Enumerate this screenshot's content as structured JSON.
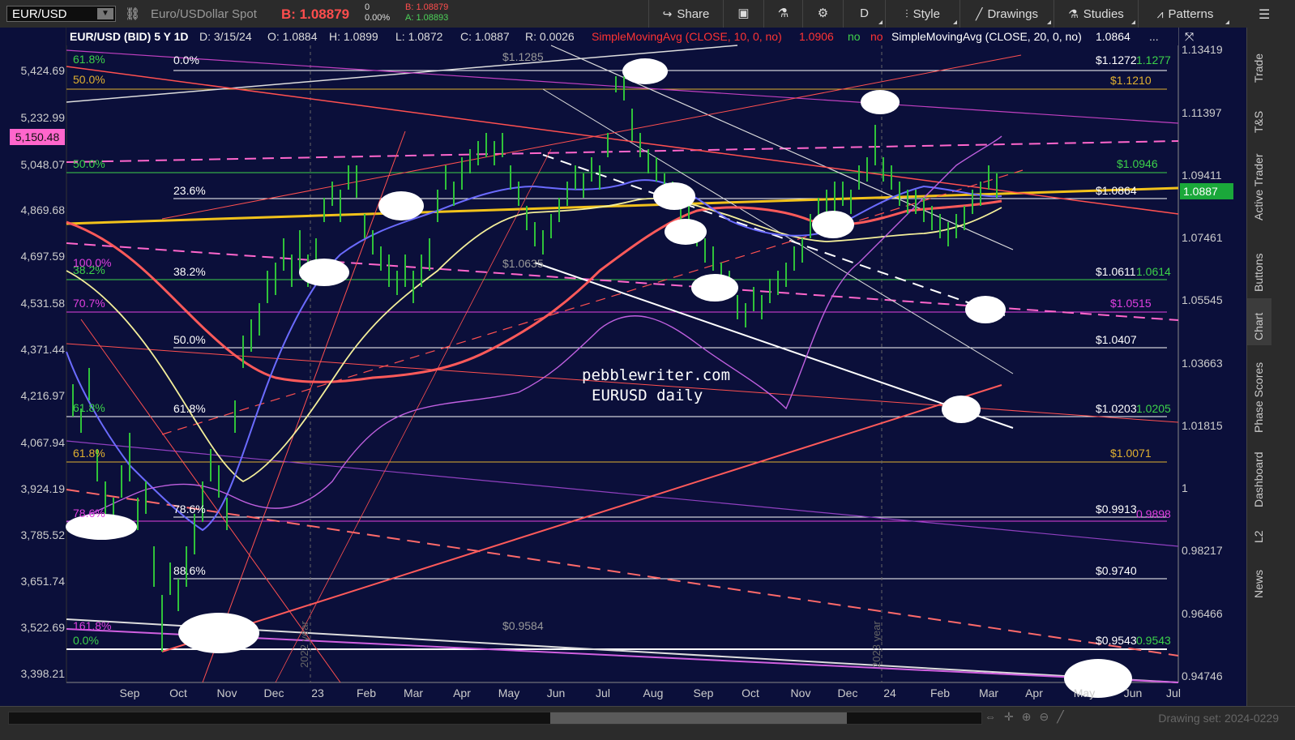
{
  "header": {
    "symbol": "EUR/USD",
    "description": "Euro/USDollar Spot",
    "bid": "B: 1.08879",
    "change": "0",
    "change_pct": "0.00%",
    "bid_small": "B: 1.08879",
    "ask_small": "A: 1.08893",
    "buttons": {
      "share": "Share",
      "period": "D",
      "style": "Style",
      "drawings": "Drawings",
      "studies": "Studies",
      "patterns": "Patterns"
    }
  },
  "chart": {
    "info": {
      "symbol_period": "EUR/USD (BID) 5 Y 1D",
      "date": "D: 3/15/24",
      "open": "O: 1.0884",
      "high": "H: 1.0899",
      "low": "L: 1.0872",
      "close": "C: 1.0887",
      "range": "R: 0.0026",
      "sma10": "SimpleMovingAvg (CLOSE, 10, 0, no)",
      "sma10_val": "1.0906",
      "no1": "no",
      "no2": "no",
      "sma20": "SimpleMovingAvg (CLOSE, 20, 0, no)",
      "sma20_val": "1.0864",
      "more": "..."
    },
    "watermark_1": "pebblewriter.com",
    "watermark_2": "EURUSD daily",
    "left_axis": [
      "5,424.69",
      "5,232.99",
      "5,048.07",
      "4,869.68",
      "4,697.59",
      "4,531.58",
      "4,371.44",
      "4,216.97",
      "4,067.94",
      "3,924.19",
      "3,785.52",
      "3,651.74",
      "3,522.69",
      "3,398.21"
    ],
    "left_current": "5,150.48",
    "right_axis": [
      "1.13419",
      "1.11397",
      "1.09411",
      "1.07461",
      "1.05545",
      "1.03663",
      "1.01815",
      "1",
      "0.98217",
      "0.96466",
      "0.94746"
    ],
    "right_current": "1.0887",
    "x_axis": [
      "Sep",
      "Oct",
      "Nov",
      "Dec",
      "23",
      "Feb",
      "Mar",
      "Apr",
      "May",
      "Jun",
      "Jul",
      "Aug",
      "Sep",
      "Oct",
      "Nov",
      "Dec",
      "24",
      "Feb",
      "Mar",
      "Apr",
      "May",
      "Jun",
      "Jul"
    ],
    "year_marks": [
      "2022 year",
      "2023 year"
    ],
    "fib_levels": [
      {
        "pct": "0.0%",
        "price": "$1.1272"
      },
      {
        "pct": "23.6%",
        "price": "$1.0864"
      },
      {
        "pct": "38.2%",
        "price": "$1.0611"
      },
      {
        "pct": "50.0%",
        "price": "$1.0407"
      },
      {
        "pct": "61.8%",
        "price": "$1.0203"
      },
      {
        "pct": "78.6%",
        "price": "$0.9913"
      },
      {
        "pct": "88.6%",
        "price": "$0.9740"
      }
    ],
    "colored_levels": {
      "a": "50.0%",
      "a_price": "$1.1210",
      "b": "50.0%",
      "b_price": "$1.0946",
      "c": "70.7%",
      "c_price": "$1.0515",
      "d": "61.8%",
      "d_price": "$1.0071",
      "e": "161.8%",
      "e_bottom": "0.0%",
      "e_price": "$0.9543",
      "f": "78.6%",
      "g": "38.2%",
      "h": "100.0%",
      "i": "61.8%",
      "j": "61.8%"
    },
    "overlap_labels": {
      "top_green": "1.1277",
      "mid_green": "1.0614",
      "green_2": "1.0205",
      "pink_low": "0.9898",
      "green_low": "0.9543"
    },
    "inline_prices": {
      "p1": "$1.1285",
      "p2": "$1.0635",
      "p3": "$0.9584"
    }
  },
  "rail": [
    "Trade",
    "T&S",
    "Active Trader",
    "Buttons",
    "Chart",
    "Phase Scores",
    "Dashboard",
    "L2",
    "News"
  ],
  "footer": {
    "drawing_set": "Drawing set: 2024-0229"
  },
  "colors": {
    "background": "#0b0f3a",
    "bid": "#ff4d4d",
    "ask": "#4dd35a",
    "price_tag": "#1aa83a",
    "left_tag": "#ff66cc"
  }
}
